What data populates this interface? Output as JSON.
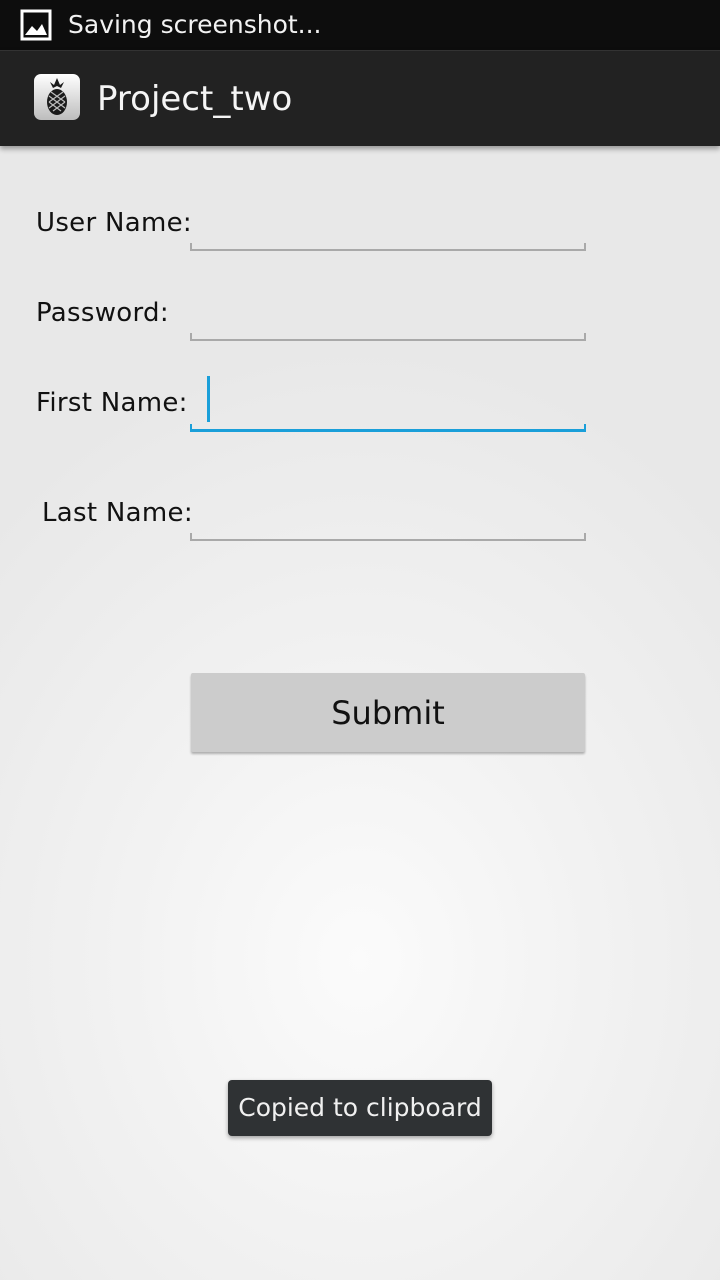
{
  "status_bar": {
    "notification_text": "Saving screenshot...",
    "icon": "image-icon"
  },
  "action_bar": {
    "title": "Project_two",
    "icon": "pineapple-app-icon"
  },
  "form": {
    "fields": [
      {
        "label": "User Name:",
        "value": "",
        "focused": false
      },
      {
        "label": "Password:",
        "value": "",
        "focused": false
      },
      {
        "label": "First Name:",
        "value": "",
        "focused": true
      },
      {
        "label": "Last Name:",
        "value": "",
        "focused": false
      }
    ],
    "submit_label": "Submit"
  },
  "toast": {
    "message": "Copied to clipboard"
  },
  "colors": {
    "status_bar": "#0d0d0d",
    "action_bar": "#222222",
    "focus_accent": "#1a9fd9",
    "button": "#cccccc",
    "toast": "#2f3234"
  }
}
